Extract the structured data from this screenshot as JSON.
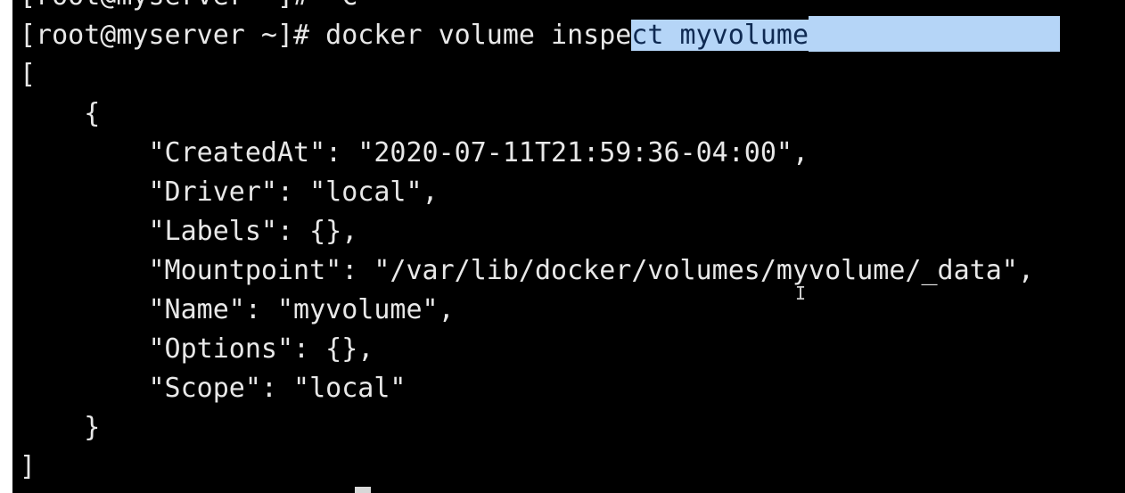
{
  "terminal": {
    "lines": [
      "[root@myserver ~]# ^C",
      "[root@myserver ~]# docker volume inspect myvolume",
      "[",
      "    {",
      "        \"CreatedAt\": \"2020-07-11T21:59:36-04:00\",",
      "        \"Driver\": \"local\",",
      "        \"Labels\": {},",
      "        \"Mountpoint\": \"/var/lib/docker/volumes/myvolume/_data\",",
      "        \"Name\": \"myvolume\",",
      "        \"Options\": {},",
      "        \"Scope\": \"local\"",
      "    }",
      "]"
    ],
    "command_unselected": "[root@myserver ~]# docker volume inspe",
    "command_selected": "ct myvolume",
    "colors": {
      "background": "#000000",
      "foreground": "#e8e8e8",
      "selection": "#b5d5f7"
    },
    "icons": {
      "text_cursor": "ibeam-cursor-icon"
    }
  }
}
